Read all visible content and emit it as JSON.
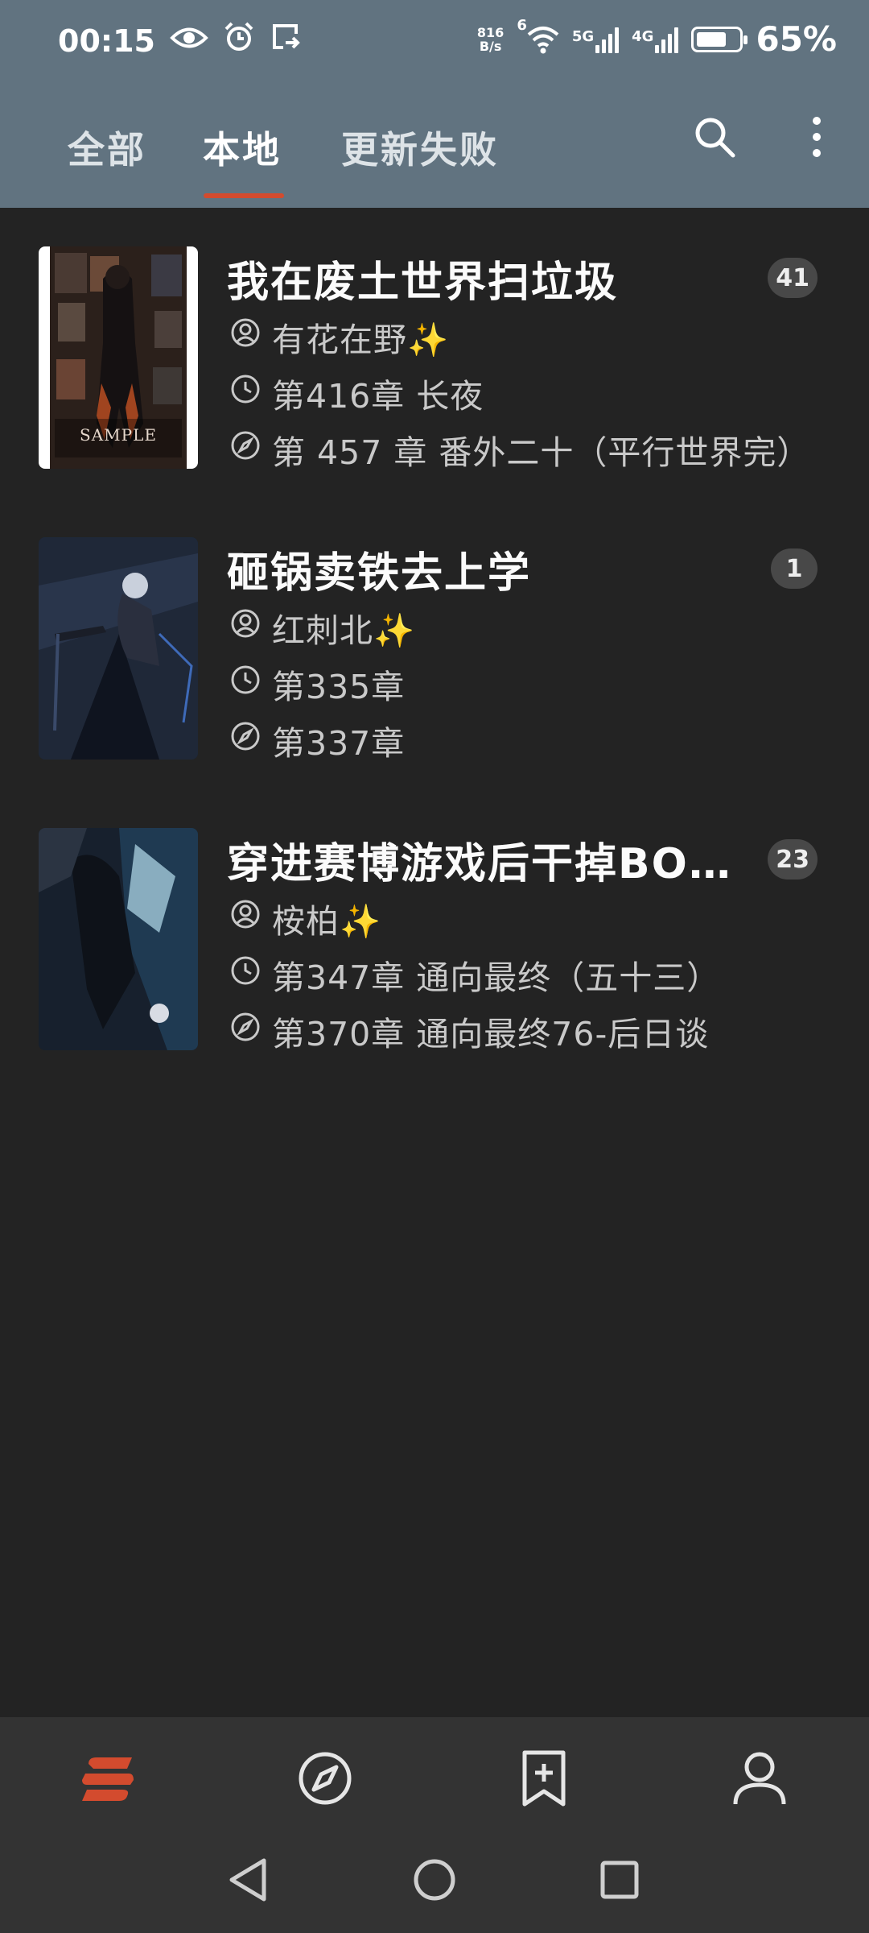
{
  "status_bar": {
    "time": "00:15",
    "net_speed_value": "816",
    "net_speed_unit": "B/s",
    "wifi_label": "6",
    "sim1_label": "5G",
    "sim2_label": "4G",
    "battery_percent": "65%"
  },
  "tabs": [
    {
      "label": "全部"
    },
    {
      "label": "本地"
    },
    {
      "label": "更新失败"
    }
  ],
  "active_tab": "本地",
  "books": [
    {
      "title": "我在废土世界扫垃圾",
      "author": "有花在野✨",
      "last_read": "第416章 长夜",
      "latest_chapter": "第 457 章 番外二十（平行世界完）",
      "badge": "41",
      "cover_text": "SAMPLE",
      "cover_colors": [
        "#3a2a22",
        "#8a4a2e",
        "#c9a58a"
      ]
    },
    {
      "title": "砸锅卖铁去上学",
      "author": "红刺北✨",
      "last_read": "第335章",
      "latest_chapter": "第337章",
      "badge": "1",
      "cover_text": "",
      "cover_colors": [
        "#2a3448",
        "#4b5a7a",
        "#9aa8c2"
      ]
    },
    {
      "title": "穿进赛博游戏后干掉BOS…",
      "author": "桉柏✨",
      "last_read": "第347章 通向最终（五十三）",
      "latest_chapter": "第370章 通向最终76-后日谈",
      "badge": "23",
      "cover_text": "",
      "cover_colors": [
        "#1c2738",
        "#3b5f7e",
        "#a6c8d8"
      ]
    }
  ],
  "colors": {
    "header_bg": "#617380",
    "accent": "#d34b2e",
    "background": "#232323",
    "nav_bg": "#333333"
  },
  "icons": {
    "status": [
      "eye-icon",
      "alarm-icon",
      "cast-icon",
      "wifi-icon",
      "signal-icon",
      "battery-icon"
    ],
    "header": [
      "search-icon",
      "more-vert-icon"
    ],
    "meta": [
      "author-icon",
      "clock-icon",
      "compass-icon"
    ],
    "bottom_nav": [
      "bookshelf-icon",
      "explore-icon",
      "bookmark-add-icon",
      "profile-icon"
    ],
    "system": [
      "back-icon",
      "home-icon",
      "recents-icon"
    ]
  }
}
